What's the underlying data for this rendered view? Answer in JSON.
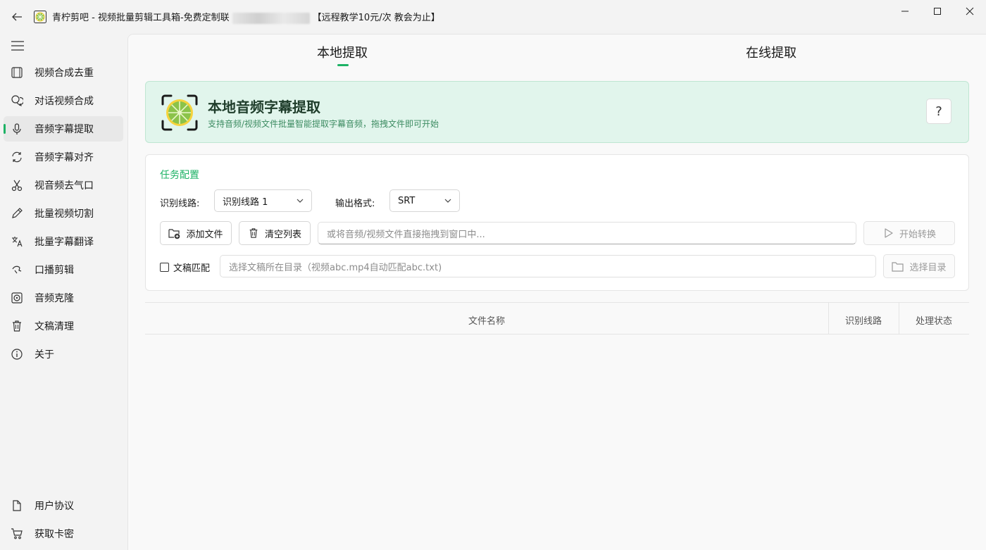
{
  "window": {
    "title_prefix": "青柠剪吧 - 视频批量剪辑工具箱-免费定制联",
    "title_suffix": "【远程教学10元/次 教会为止】"
  },
  "sidebar": {
    "items": [
      {
        "label": "视频合成去重",
        "icon": "film-icon"
      },
      {
        "label": "对话视频合成",
        "icon": "chat-icon"
      },
      {
        "label": "音频字幕提取",
        "icon": "mic-icon",
        "active": true
      },
      {
        "label": "音频字幕对齐",
        "icon": "sync-icon"
      },
      {
        "label": "视音频去气口",
        "icon": "scissors-icon"
      },
      {
        "label": "批量视频切割",
        "icon": "pen-icon"
      },
      {
        "label": "批量字幕翻译",
        "icon": "translate-icon"
      },
      {
        "label": "口播剪辑",
        "icon": "speech-icon"
      },
      {
        "label": "音频克隆",
        "icon": "speaker-icon"
      },
      {
        "label": "文稿清理",
        "icon": "trash-icon"
      },
      {
        "label": "关于",
        "icon": "info-icon"
      }
    ],
    "bottom_items": [
      {
        "label": "用户协议",
        "icon": "document-icon"
      },
      {
        "label": "获取卡密",
        "icon": "cart-icon"
      }
    ]
  },
  "tabs": {
    "local": "本地提取",
    "online": "在线提取"
  },
  "banner": {
    "title": "本地音频字幕提取",
    "subtitle": "支持音频/视频文件批量智能提取字幕音频，拖拽文件即可开始",
    "help": "?"
  },
  "config": {
    "title": "任务配置",
    "route_label": "识别线路:",
    "route_value": "识别线路 1",
    "format_label": "输出格式:",
    "format_value": "SRT",
    "add_file": "添加文件",
    "clear_list": "清空列表",
    "drop_placeholder": "或将音频/视频文件直接拖拽到窗口中...",
    "start": "开始转换",
    "match_label": "文稿匹配",
    "dir_placeholder": "选择文稿所在目录（视频abc.mp4自动匹配abc.txt)",
    "select_dir": "选择目录"
  },
  "table": {
    "columns": [
      "文件名称",
      "识别线路",
      "处理状态"
    ]
  },
  "colors": {
    "accent": "#1db265",
    "banner_bg": "#e1f5ec"
  }
}
